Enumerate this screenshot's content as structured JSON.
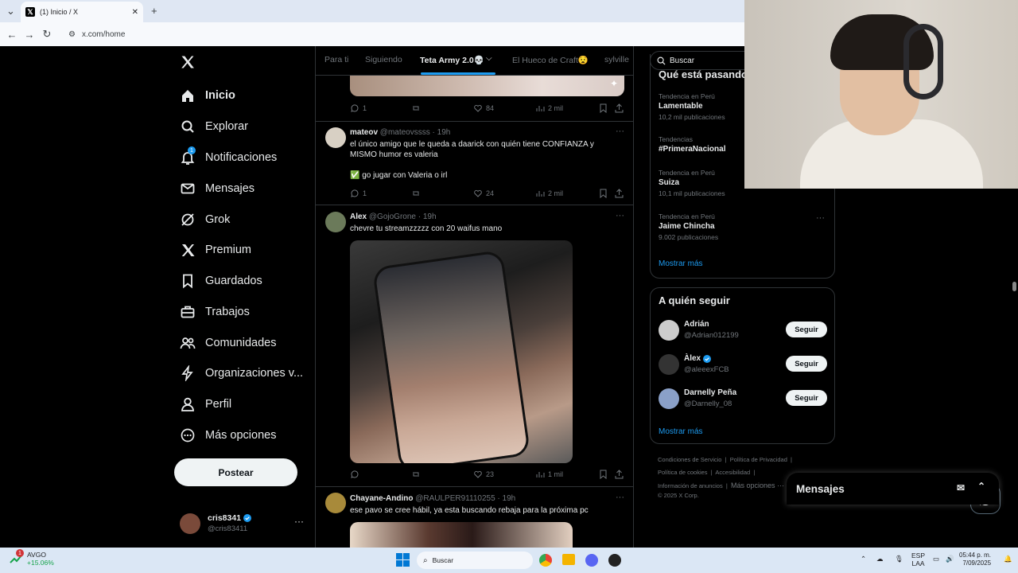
{
  "browser": {
    "tab_title": "(1) Inicio / X",
    "url": "x.com/home"
  },
  "nav": {
    "items": [
      {
        "label": "Inicio",
        "icon": "home-icon",
        "bold": true
      },
      {
        "label": "Explorar",
        "icon": "search-icon"
      },
      {
        "label": "Notificaciones",
        "icon": "bell-icon",
        "badge": "1"
      },
      {
        "label": "Mensajes",
        "icon": "mail-icon"
      },
      {
        "label": "Grok",
        "icon": "grok-icon"
      },
      {
        "label": "Premium",
        "icon": "x-icon"
      },
      {
        "label": "Guardados",
        "icon": "bookmark-icon"
      },
      {
        "label": "Trabajos",
        "icon": "briefcase-icon"
      },
      {
        "label": "Comunidades",
        "icon": "people-icon"
      },
      {
        "label": "Organizaciones v...",
        "icon": "lightning-icon"
      },
      {
        "label": "Perfil",
        "icon": "person-icon"
      },
      {
        "label": "Más opciones",
        "icon": "more-circle-icon"
      }
    ],
    "post_button": "Postear",
    "account": {
      "name": "cris8341",
      "handle": "@cris83411"
    }
  },
  "feed": {
    "tabs": [
      "Para ti",
      "Siguiendo",
      "Teta Army 2.0💀",
      "El Hueco de Craft😧",
      "sylville"
    ],
    "post0": {
      "replies": "1",
      "likes": "84",
      "views": "2 mil"
    },
    "post1": {
      "name": "mateov",
      "handle": "@mateovssss",
      "time": "· 19h",
      "text1": "el único amigo que le queda a daarick con quién tiene CONFIANZA y MISMO humor es valeria",
      "text2": "✅ go jugar con Valeria o irl",
      "replies": "1",
      "likes": "24",
      "views": "2 mil"
    },
    "post2": {
      "name": "Alex",
      "handle": "@GojoGrone",
      "time": "· 19h",
      "text": "chevre tu streamzzzzz con 20 waifus mano",
      "likes": "23",
      "views": "1 mil"
    },
    "post3": {
      "name": "Chayane-Andino",
      "handle": "@RAULPER91110255",
      "time": "· 19h",
      "text": "ese pavo se cree hábil, ya esta buscando rebaja para la próxima pc"
    }
  },
  "right": {
    "search_placeholder": "Buscar",
    "trends_title": "Qué está pasando",
    "trends": [
      {
        "context": "Tendencia en Perú",
        "title": "Lamentable",
        "count": "10,2 mil publicaciones"
      },
      {
        "context": "Tendencias",
        "title": "#PrimeraNacional",
        "count": ""
      },
      {
        "context": "Tendencia en Perú",
        "title": "Suiza",
        "count": "10,1 mil publicaciones"
      },
      {
        "context": "Tendencia en Perú",
        "title": "Jaime Chincha",
        "count": "9.002 publicaciones"
      }
    ],
    "show_more": "Mostrar más",
    "who_title": "A quién seguir",
    "who": [
      {
        "name": "Adrián",
        "handle": "@Adrian012199",
        "btn": "Seguir"
      },
      {
        "name": "Àlex",
        "handle": "@aleeexFCB",
        "btn": "Seguir"
      },
      {
        "name": "Darnelly Peña",
        "handle": "@Darnelly_08",
        "btn": "Seguir"
      }
    ],
    "footer": [
      "Condiciones de Servicio",
      "Política de Privacidad",
      "Política de cookies",
      "Accesibilidad",
      "Información de anuncios",
      "Más opciones ···",
      "© 2025 X Corp."
    ],
    "messages": "Mensajes"
  },
  "taskbar": {
    "stock_name": "AVGO",
    "stock_change": "+15.06%",
    "search": "Buscar",
    "lang1": "ESP",
    "lang2": "LAA",
    "time": "05:44 p. m.",
    "date": "7/09/2025",
    "notif": "1"
  }
}
